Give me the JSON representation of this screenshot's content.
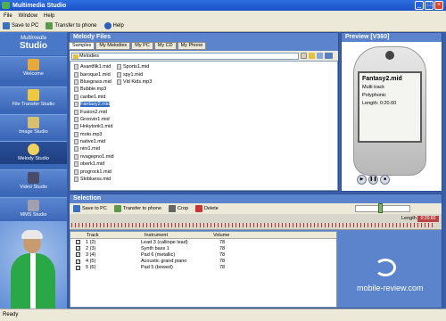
{
  "window": {
    "title": "Multimedia Studio"
  },
  "menu": [
    "File",
    "Window",
    "Help"
  ],
  "toolbar": {
    "save_to_pc": "Save to PC",
    "transfer": "Transfer to phone",
    "help": "Help"
  },
  "sidebar": {
    "logo_top": "Multimedia",
    "logo_bottom": "Studio",
    "items": [
      {
        "label": "Welcome",
        "color": "#e8a93a"
      },
      {
        "label": "File Transfer Studio",
        "color": "#f0c840"
      },
      {
        "label": "Image Studio",
        "color": "#d8c070"
      },
      {
        "label": "Melody Studio",
        "color": "#f0d060"
      },
      {
        "label": "Video Studio",
        "color": "#4a4a6a"
      },
      {
        "label": "MMS Studio",
        "color": "#a0a0b0"
      }
    ]
  },
  "melody_files": {
    "title": "Melody Files",
    "tabs": [
      "Samples",
      "My Melodies",
      "My PC",
      "My CD",
      "My Phone"
    ],
    "path": "Melodies",
    "column1": [
      "Avantfilk1.mid",
      "baroque1.mid",
      "Bluegrass.mid",
      "Bubble.mp3",
      "caribe1.mid",
      "Fantasy2.mid",
      "Fusion2.mid",
      "Groovin1.mid",
      "Hnkytonk1.mid",
      "moto.mp3",
      "native1.mid",
      "nini1.mid",
      "nvagepno1.mid",
      "oberk1.mid",
      "progrock1.mid",
      "Slobluess.mid"
    ],
    "column2": [
      "Sports1.mid",
      "spy1.mid",
      "Vid Kids.mp3"
    ],
    "selected": "Fantasy2.mid"
  },
  "preview": {
    "title": "Preview [V360]",
    "screen_title": "Fantasy2.mid",
    "line1": "Multi track",
    "line2": "Polyphonic",
    "line3": "Length: 0:20.60"
  },
  "selection": {
    "title": "Selection",
    "toolbar": {
      "save_to_pc": "Save to PC",
      "transfer": "Transfer to phone",
      "crop": "Crop",
      "delete": "Delete"
    },
    "length_label": "Length",
    "length_value": "0:20.60",
    "columns": [
      "Track",
      "Instrument",
      "Volume"
    ],
    "tracks": [
      {
        "track": "1 (2)",
        "instrument": "Lead 3 (calliope lead)",
        "volume": "78"
      },
      {
        "track": "2 (3)",
        "instrument": "Synth bass 1",
        "volume": "78"
      },
      {
        "track": "3 (4)",
        "instrument": "Pad 6 (metallic)",
        "volume": "78"
      },
      {
        "track": "4 (5)",
        "instrument": "Acoustic grand piano",
        "volume": "78"
      },
      {
        "track": "5 (6)",
        "instrument": "Pad 5 (bowed)",
        "volume": "78"
      }
    ]
  },
  "watermark": "mobile-review.com",
  "status": "Ready"
}
